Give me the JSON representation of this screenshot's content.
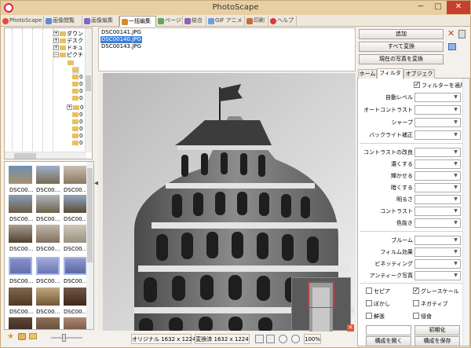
{
  "window": {
    "title": "PhotoScape",
    "minimize": "─",
    "maximize": "□",
    "close": "✕"
  },
  "colors": {
    "title_bar": "#e8cfa3",
    "close_btn": "#c7402f",
    "selection": "#3b7fd9"
  },
  "tabs": [
    {
      "label": "PhotoScape",
      "icon": "photoscape-logo-icon"
    },
    {
      "label": "画像閲覧",
      "icon": "viewer-icon"
    },
    {
      "label": "画像編集",
      "icon": "editor-icon"
    },
    {
      "label": "一括編集",
      "icon": "batch-editor-icon",
      "active": true
    },
    {
      "label": "ページ",
      "icon": "page-icon"
    },
    {
      "label": "結合",
      "icon": "combine-icon"
    },
    {
      "label": "GIF アニメ",
      "icon": "gif-icon"
    },
    {
      "label": "印刷",
      "icon": "print-icon"
    },
    {
      "label": "ヘルプ",
      "icon": "help-icon"
    }
  ],
  "tree": {
    "items": [
      {
        "expander": "+",
        "label": "ダウン"
      },
      {
        "expander": "+",
        "label": "デスク"
      },
      {
        "expander": "+",
        "label": "ドキュ"
      },
      {
        "expander": "−",
        "label": "ピクチ"
      }
    ],
    "sub_labels": [
      "0",
      "0",
      "0",
      "0",
      "0",
      "0",
      "0",
      "0",
      "0",
      "0",
      "0",
      "0",
      "0"
    ]
  },
  "thumbnails": {
    "label": "DSC00...",
    "sidebar_up": "▲",
    "sidebar_down": "▼"
  },
  "file_list": [
    "DSC00141.JPG",
    "DSC00140.JPG",
    "DSC00143.JPG"
  ],
  "status": {
    "original": "オリジナル 1632 x 1224",
    "converted": "変換済 1632 x 1224",
    "zoom": "100%"
  },
  "right_panel": {
    "add": "追加",
    "convert_all": "すべて変換",
    "convert_current": "現在の写真を変換",
    "tabs": [
      "ホーム",
      "フィルター",
      "オブジェクト"
    ],
    "apply_filter": "フィルターを適用",
    "filters_group1": [
      "自動レベル",
      "オートコントラスト",
      "シャープ",
      "バックライト補正"
    ],
    "filters_group2": [
      "コントラストの改良",
      "濃くする",
      "輝かせる",
      "暗くする",
      "明るさ",
      "コントラスト",
      "色抜き"
    ],
    "filters_group3": [
      "ブルーム",
      "フィルム効果",
      "ビネッティング",
      "アンティーク写真"
    ],
    "checks": [
      {
        "label": "セピア",
        "checked": false
      },
      {
        "label": "グレースケール",
        "checked": true
      },
      {
        "label": "ぼかし",
        "checked": false
      },
      {
        "label": "ネガティブ",
        "checked": false
      },
      {
        "label": "鮮張",
        "checked": false
      },
      {
        "label": "侵食",
        "checked": false
      }
    ],
    "reset": "初期化",
    "open_config": "構成を開く",
    "save_config": "構成を保存"
  }
}
